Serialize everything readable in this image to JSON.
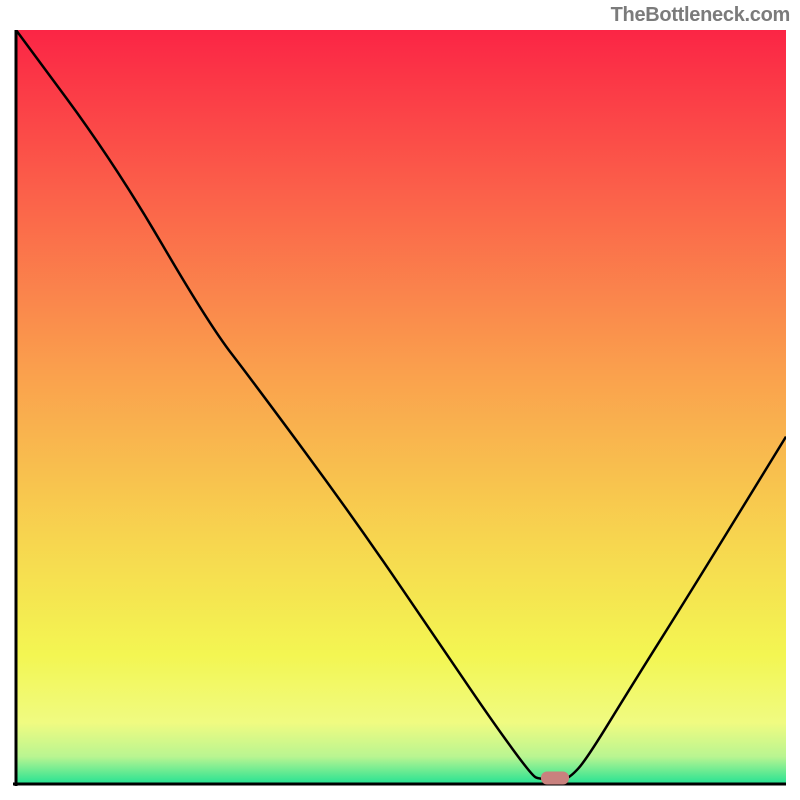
{
  "attribution": "TheBottleneck.com",
  "chart_data": {
    "type": "line",
    "title": "",
    "xlabel": "",
    "ylabel": "",
    "xlim": [
      0,
      100
    ],
    "ylim": [
      0,
      100
    ],
    "series": [
      {
        "name": "curve",
        "x": [
          0,
          13,
          25,
          31,
          44,
          56,
          62,
          67,
          68,
          71,
          72,
          74,
          80,
          88,
          100
        ],
        "y": [
          100,
          82,
          61,
          53,
          35,
          17,
          8,
          1,
          0.5,
          0.5,
          0.8,
          3,
          13,
          26,
          46
        ]
      }
    ],
    "marker": {
      "x": 70,
      "y": 0.6,
      "color": "#c9817e"
    },
    "gradient_colors": {
      "top": "#fb2545",
      "c1": "#fb644a",
      "c2": "#fa9f4d",
      "c3": "#f7d64f",
      "c4": "#f3f652",
      "c5": "#f0fb81",
      "c6": "#b9f591",
      "bottom": "#2ae393"
    },
    "axis_color": "#000000",
    "line_color": "#000000"
  }
}
